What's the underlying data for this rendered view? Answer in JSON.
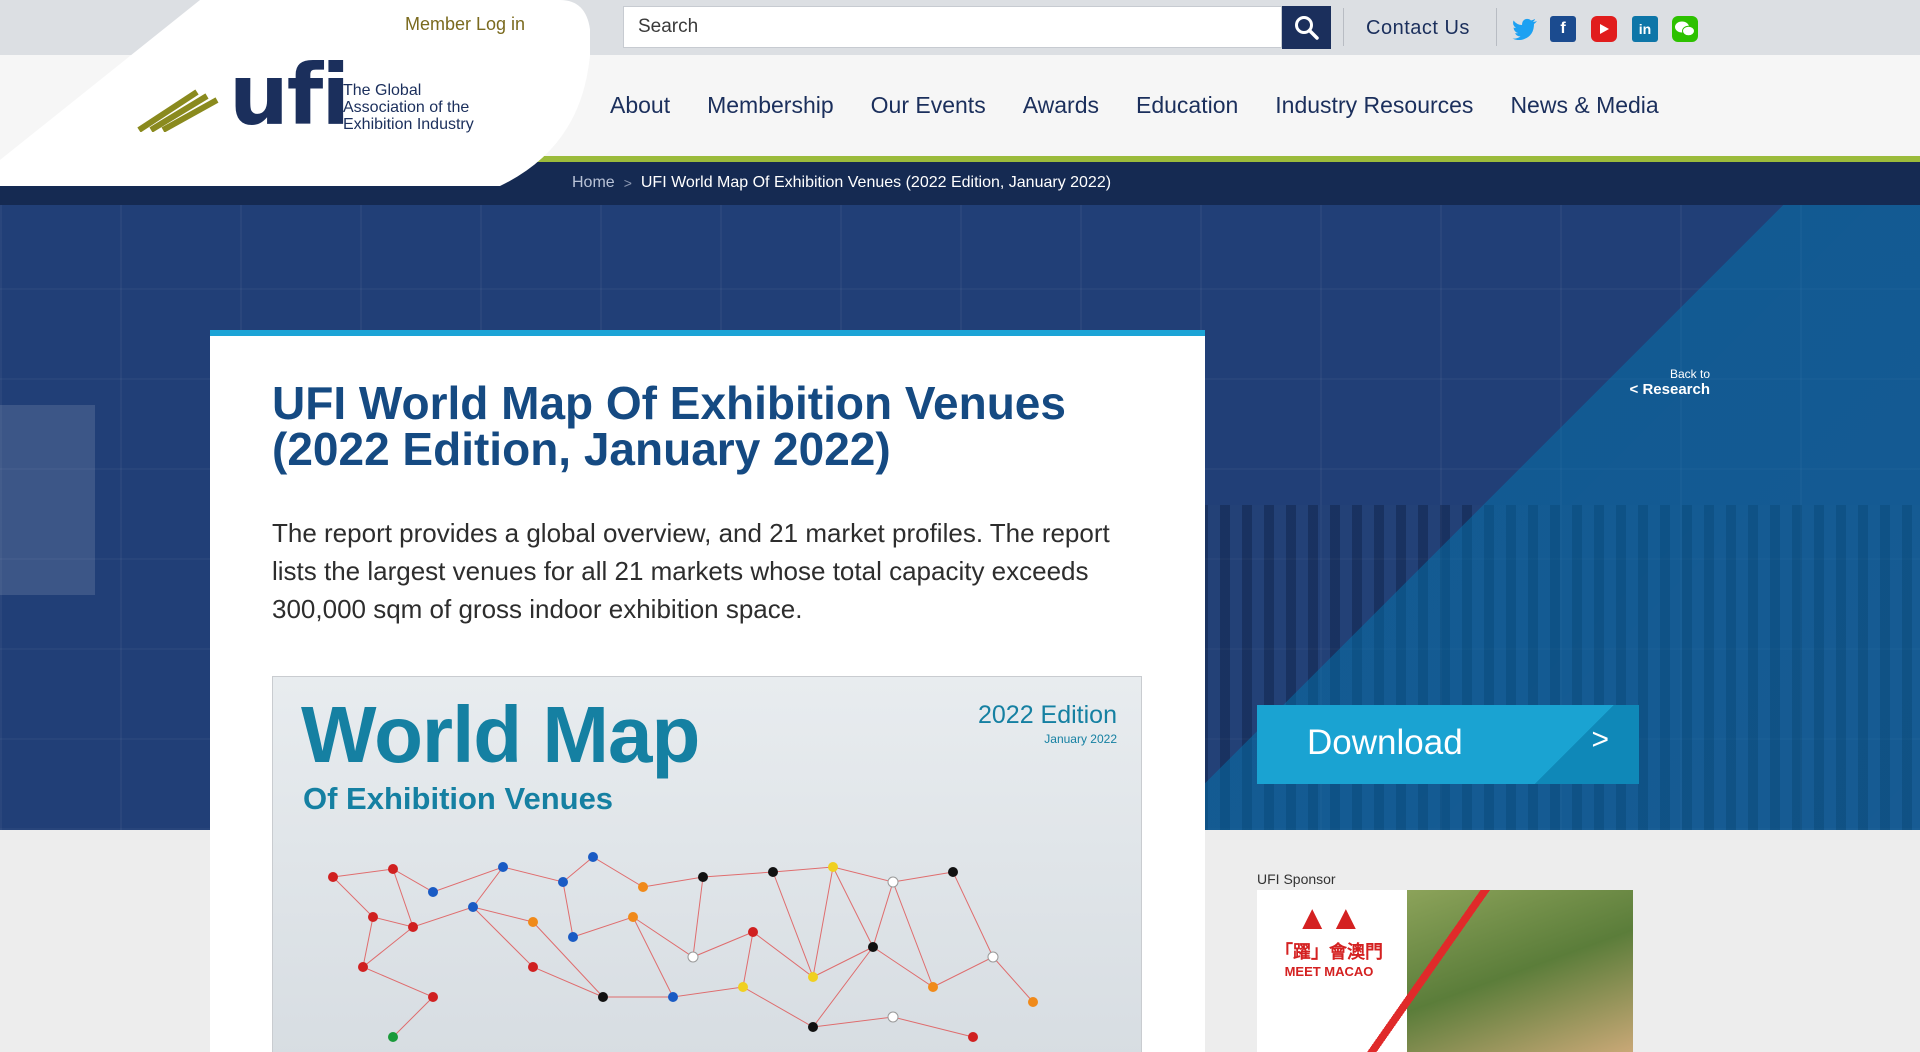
{
  "header": {
    "member_login": "Member Log in",
    "logo_text": "ufi",
    "logo_tagline": "The Global Association of the Exhibition Industry",
    "search_placeholder": "Search",
    "contact": "Contact Us",
    "social_icons": [
      "twitter-icon",
      "facebook-icon",
      "youtube-icon",
      "linkedin-icon",
      "wechat-icon"
    ]
  },
  "nav": {
    "items": [
      "About",
      "Membership",
      "Our Events",
      "Awards",
      "Education",
      "Industry Resources",
      "News & Media"
    ]
  },
  "breadcrumb": {
    "home": "Home",
    "current": "UFI World Map Of Exhibition Venues (2022 Edition, January 2022)"
  },
  "hero": {
    "back_small": "Back to",
    "back_link": "Research",
    "download_label": "Download"
  },
  "card": {
    "title": "UFI World Map Of Exhibition Venues (2022 Edition, January 2022)",
    "description": "The report provides a global overview, and 21 market profiles. The report lists the largest venues for all 21 markets whose total capacity exceeds 300,000 sqm of gross indoor exhibition space.",
    "cover": {
      "title": "World Map",
      "subtitle": "Of Exhibition Venues",
      "edition": "2022 Edition",
      "date": "January 2022"
    }
  },
  "sponsor": {
    "label": "UFI Sponsor",
    "brand_cn": "「躍」會澳門",
    "brand_en": "MEET MACAO"
  },
  "colors": {
    "navy": "#1b2f5c",
    "accent_blue": "#1aa3d2",
    "green_line": "#9bbb3b",
    "title_blue": "#154a82"
  }
}
